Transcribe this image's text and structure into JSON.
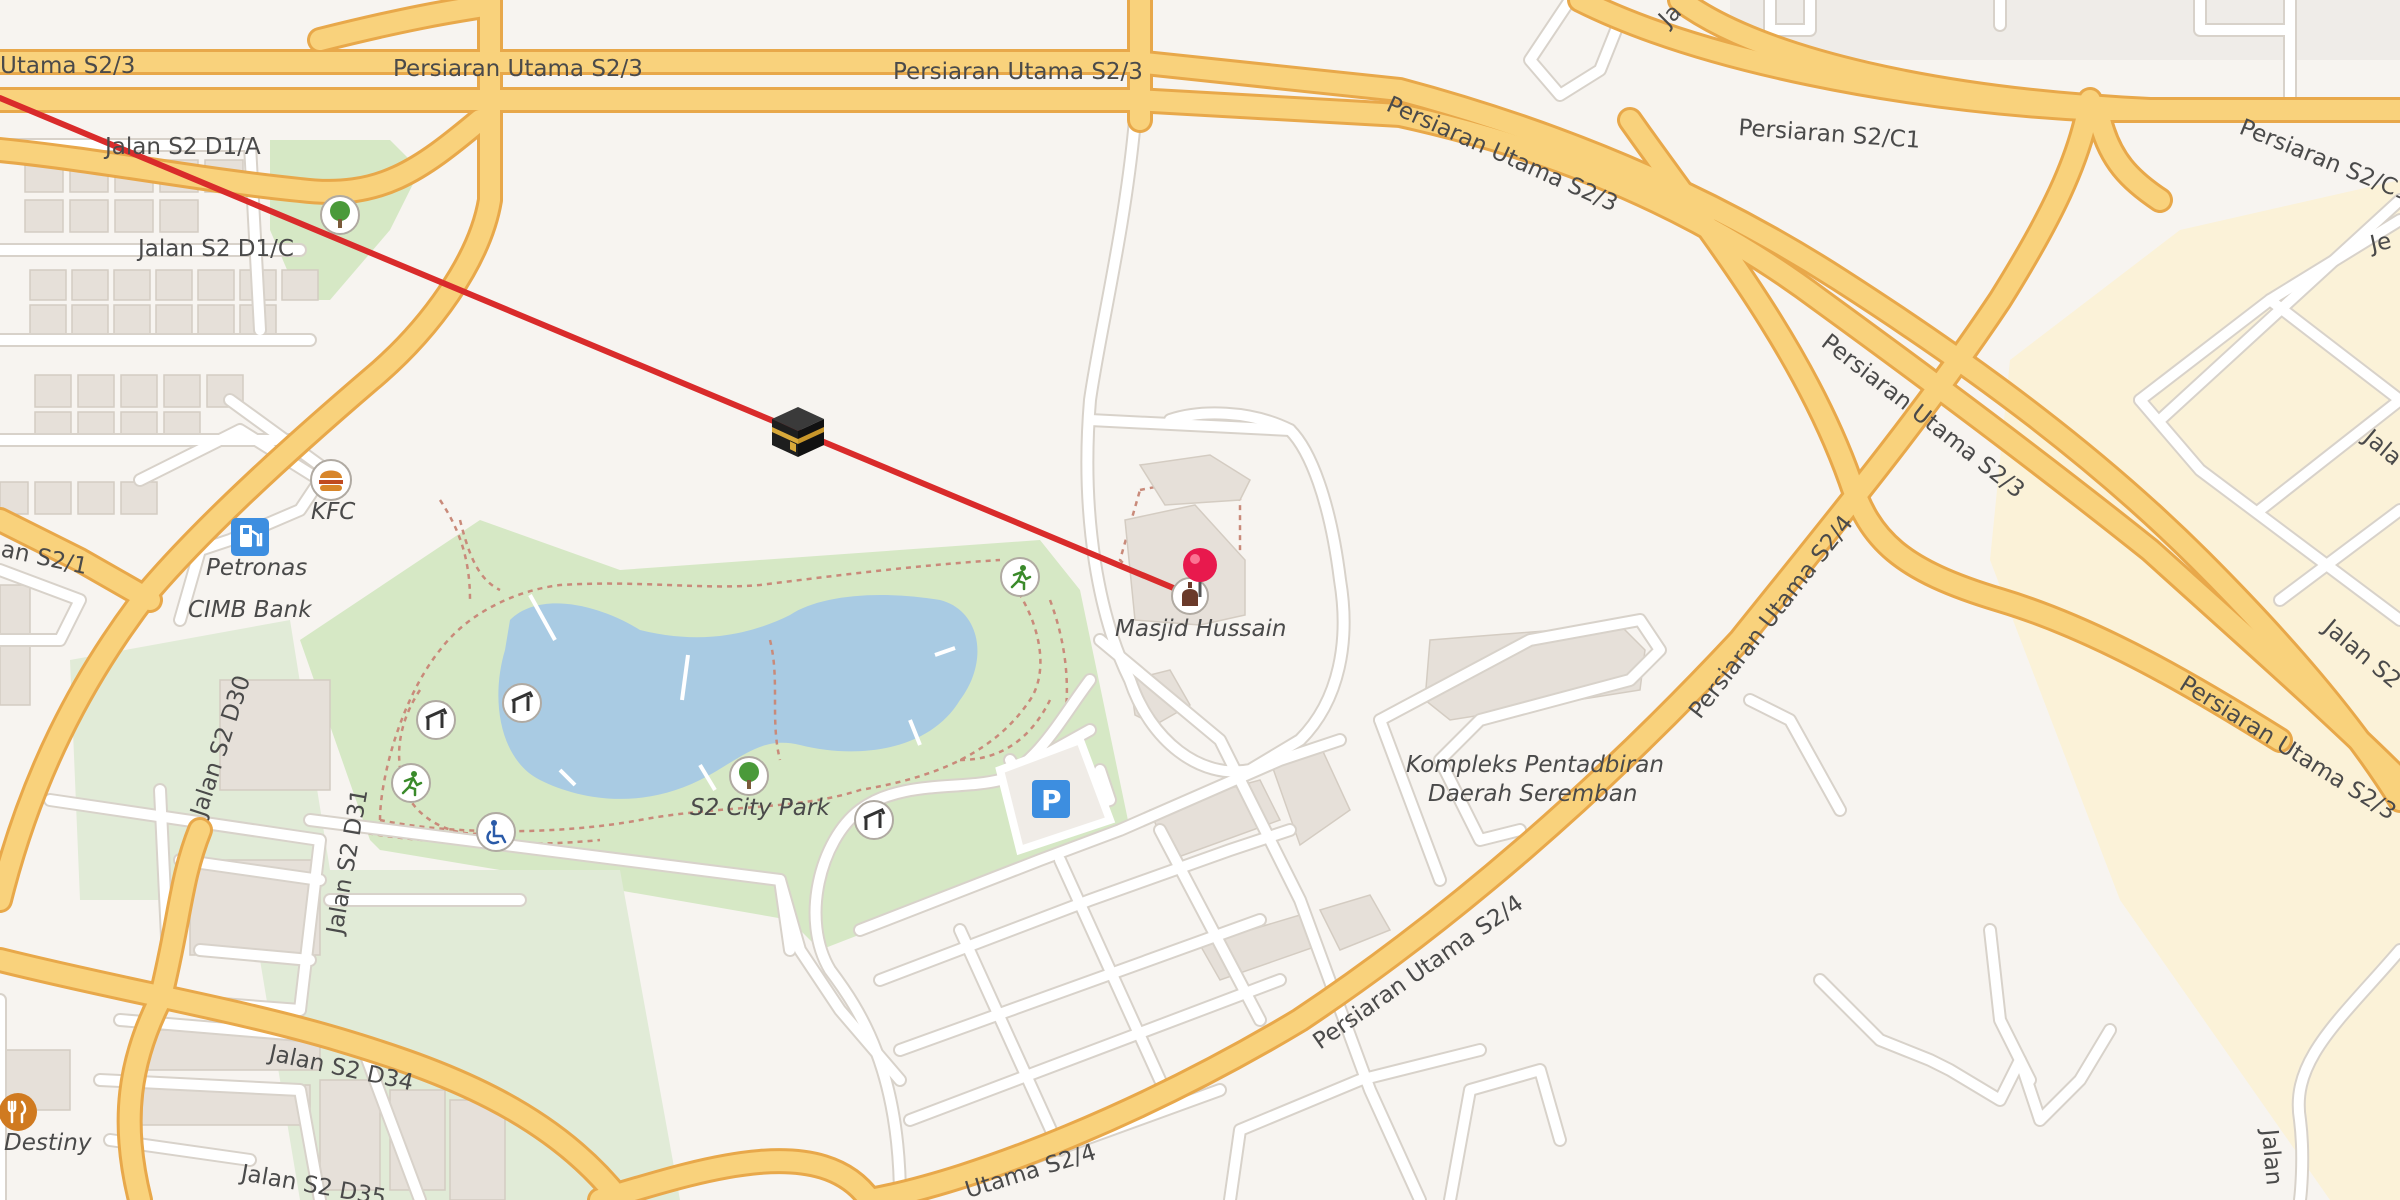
{
  "map": {
    "colors": {
      "land": "#f7f4f0",
      "park": "#d6e8c5",
      "water": "#a9cbe3",
      "major_road": "#f9d27c",
      "major_road_casing": "#e8a84a",
      "qibla_line": "#d92b2b",
      "pin": "#e8194d",
      "commercial": "#fbf2d8"
    },
    "road_labels": {
      "persiaran_utama_s23_a": "Utama S2/3",
      "persiaran_utama_s23_b": "Persiaran Utama S2/3",
      "persiaran_utama_s23_c": "Persiaran Utama S2/3",
      "persiaran_utama_s23_d": "Persiaran Utama S2/3",
      "persiaran_utama_s23_e": "Persiaran Utama S2/3",
      "persiaran_utama_s23_f": "Persiaran Utama S2/3",
      "persiaran_s2c1": "Persiaran S2/C1",
      "persiaran_s2c1_b": "Persiaran S2/C1",
      "persiaran_utama_s24_a": "Persiaran Utama S2/4",
      "persiaran_utama_s24_b": "Persiaran Utama S2/4",
      "utama_s24": "Utama S2/4",
      "jalan_s2_d1a": "Jalan S2 D1/A",
      "jalan_s2_d1c": "Jalan S2 D1/C",
      "jalan_s2_d30": "Jalan S2 D30",
      "jalan_s2_d31": "Jalan S2 D31",
      "jalan_s2_d34": "Jalan S2 D34",
      "jalan_s2_d35": "Jalan S2 D35",
      "an_s21": "an S2/1",
      "ja_top": "Ja",
      "je": "Je",
      "jala": "Jala",
      "jalan_s2": "Jalan S2",
      "jalan_bottom": "Jalan"
    },
    "poi_labels": {
      "kfc": "KFC",
      "petronas": "Petronas",
      "cimb": "CIMB Bank",
      "masjid": "Masjid Hussain",
      "city_park": "S2 City Park",
      "kompleks_line1": "Kompleks Pentadbiran",
      "kompleks_line2": "Daerah Seremban",
      "destiny": "Destiny",
      "parking": "P"
    },
    "icons": [
      "kaaba-icon",
      "location-pin-icon",
      "tree-icon",
      "fuel-icon",
      "burger-icon",
      "shelter-icon",
      "running-icon",
      "wheelchair-icon",
      "parking-icon",
      "restaurant-icon",
      "mosque-icon"
    ]
  }
}
